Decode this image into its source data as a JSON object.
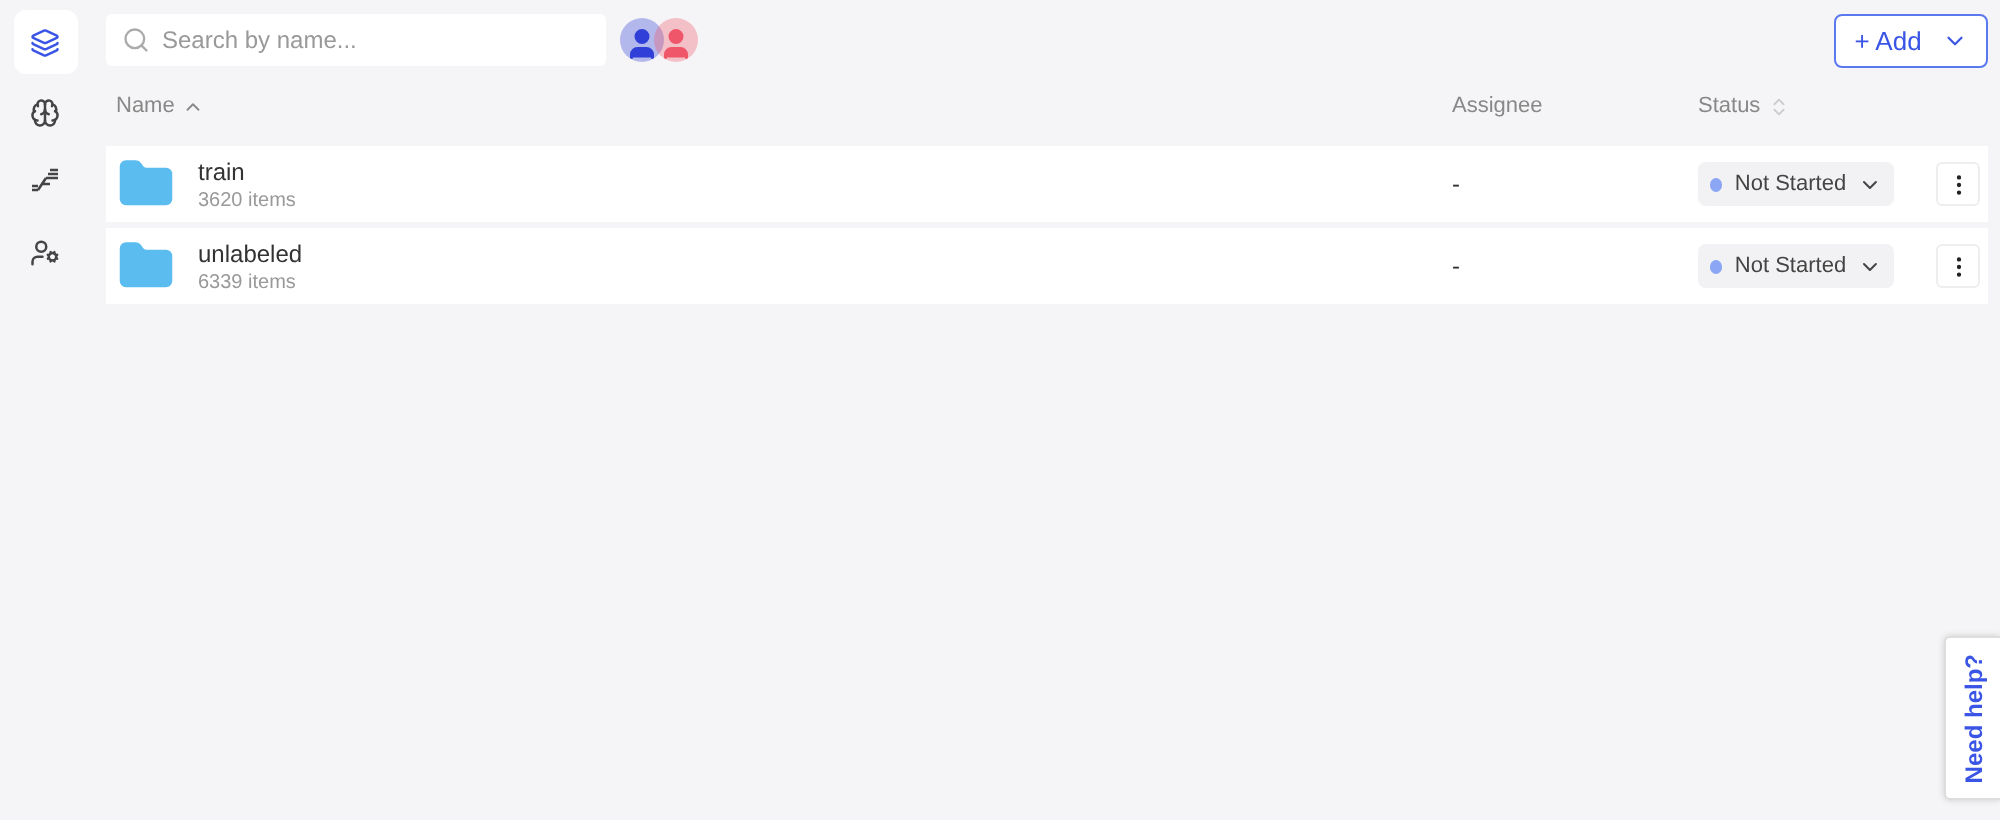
{
  "sidebar": {
    "items": [
      {
        "kind": "layers",
        "selected": true
      },
      {
        "kind": "brain",
        "selected": false
      },
      {
        "kind": "steps",
        "selected": false
      },
      {
        "kind": "users",
        "selected": false
      }
    ]
  },
  "search": {
    "placeholder": "Search by name..."
  },
  "avatars": [
    {
      "color": "#2f3fd8"
    },
    {
      "color": "#f0566a"
    }
  ],
  "add_button": {
    "label": "+ Add"
  },
  "table": {
    "columns": [
      {
        "label": "Name",
        "kind": "sorted"
      },
      {
        "label": "Assignee",
        "kind": "plain"
      },
      {
        "label": "Status",
        "kind": "sortable"
      }
    ],
    "rows": [
      {
        "name": "train",
        "count": "3620 items",
        "assignee": "-",
        "status": {
          "label": "Not Started",
          "color": "#8aa6f5"
        }
      },
      {
        "name": "unlabeled",
        "count": "6339 items",
        "assignee": "-",
        "status": {
          "label": "Not Started",
          "color": "#8aa6f5"
        }
      }
    ]
  },
  "help_tab": {
    "label": "Need help?"
  }
}
